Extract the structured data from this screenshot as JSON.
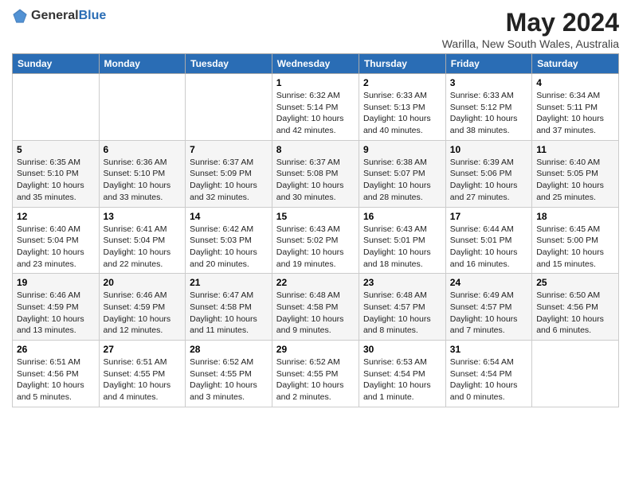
{
  "logo": {
    "general": "General",
    "blue": "Blue"
  },
  "header": {
    "title": "May 2024",
    "location": "Warilla, New South Wales, Australia"
  },
  "days_of_week": [
    "Sunday",
    "Monday",
    "Tuesday",
    "Wednesday",
    "Thursday",
    "Friday",
    "Saturday"
  ],
  "weeks": [
    [
      {
        "day": "",
        "info": ""
      },
      {
        "day": "",
        "info": ""
      },
      {
        "day": "",
        "info": ""
      },
      {
        "day": "1",
        "info": "Sunrise: 6:32 AM\nSunset: 5:14 PM\nDaylight: 10 hours\nand 42 minutes."
      },
      {
        "day": "2",
        "info": "Sunrise: 6:33 AM\nSunset: 5:13 PM\nDaylight: 10 hours\nand 40 minutes."
      },
      {
        "day": "3",
        "info": "Sunrise: 6:33 AM\nSunset: 5:12 PM\nDaylight: 10 hours\nand 38 minutes."
      },
      {
        "day": "4",
        "info": "Sunrise: 6:34 AM\nSunset: 5:11 PM\nDaylight: 10 hours\nand 37 minutes."
      }
    ],
    [
      {
        "day": "5",
        "info": "Sunrise: 6:35 AM\nSunset: 5:10 PM\nDaylight: 10 hours\nand 35 minutes."
      },
      {
        "day": "6",
        "info": "Sunrise: 6:36 AM\nSunset: 5:10 PM\nDaylight: 10 hours\nand 33 minutes."
      },
      {
        "day": "7",
        "info": "Sunrise: 6:37 AM\nSunset: 5:09 PM\nDaylight: 10 hours\nand 32 minutes."
      },
      {
        "day": "8",
        "info": "Sunrise: 6:37 AM\nSunset: 5:08 PM\nDaylight: 10 hours\nand 30 minutes."
      },
      {
        "day": "9",
        "info": "Sunrise: 6:38 AM\nSunset: 5:07 PM\nDaylight: 10 hours\nand 28 minutes."
      },
      {
        "day": "10",
        "info": "Sunrise: 6:39 AM\nSunset: 5:06 PM\nDaylight: 10 hours\nand 27 minutes."
      },
      {
        "day": "11",
        "info": "Sunrise: 6:40 AM\nSunset: 5:05 PM\nDaylight: 10 hours\nand 25 minutes."
      }
    ],
    [
      {
        "day": "12",
        "info": "Sunrise: 6:40 AM\nSunset: 5:04 PM\nDaylight: 10 hours\nand 23 minutes."
      },
      {
        "day": "13",
        "info": "Sunrise: 6:41 AM\nSunset: 5:04 PM\nDaylight: 10 hours\nand 22 minutes."
      },
      {
        "day": "14",
        "info": "Sunrise: 6:42 AM\nSunset: 5:03 PM\nDaylight: 10 hours\nand 20 minutes."
      },
      {
        "day": "15",
        "info": "Sunrise: 6:43 AM\nSunset: 5:02 PM\nDaylight: 10 hours\nand 19 minutes."
      },
      {
        "day": "16",
        "info": "Sunrise: 6:43 AM\nSunset: 5:01 PM\nDaylight: 10 hours\nand 18 minutes."
      },
      {
        "day": "17",
        "info": "Sunrise: 6:44 AM\nSunset: 5:01 PM\nDaylight: 10 hours\nand 16 minutes."
      },
      {
        "day": "18",
        "info": "Sunrise: 6:45 AM\nSunset: 5:00 PM\nDaylight: 10 hours\nand 15 minutes."
      }
    ],
    [
      {
        "day": "19",
        "info": "Sunrise: 6:46 AM\nSunset: 4:59 PM\nDaylight: 10 hours\nand 13 minutes."
      },
      {
        "day": "20",
        "info": "Sunrise: 6:46 AM\nSunset: 4:59 PM\nDaylight: 10 hours\nand 12 minutes."
      },
      {
        "day": "21",
        "info": "Sunrise: 6:47 AM\nSunset: 4:58 PM\nDaylight: 10 hours\nand 11 minutes."
      },
      {
        "day": "22",
        "info": "Sunrise: 6:48 AM\nSunset: 4:58 PM\nDaylight: 10 hours\nand 9 minutes."
      },
      {
        "day": "23",
        "info": "Sunrise: 6:48 AM\nSunset: 4:57 PM\nDaylight: 10 hours\nand 8 minutes."
      },
      {
        "day": "24",
        "info": "Sunrise: 6:49 AM\nSunset: 4:57 PM\nDaylight: 10 hours\nand 7 minutes."
      },
      {
        "day": "25",
        "info": "Sunrise: 6:50 AM\nSunset: 4:56 PM\nDaylight: 10 hours\nand 6 minutes."
      }
    ],
    [
      {
        "day": "26",
        "info": "Sunrise: 6:51 AM\nSunset: 4:56 PM\nDaylight: 10 hours\nand 5 minutes."
      },
      {
        "day": "27",
        "info": "Sunrise: 6:51 AM\nSunset: 4:55 PM\nDaylight: 10 hours\nand 4 minutes."
      },
      {
        "day": "28",
        "info": "Sunrise: 6:52 AM\nSunset: 4:55 PM\nDaylight: 10 hours\nand 3 minutes."
      },
      {
        "day": "29",
        "info": "Sunrise: 6:52 AM\nSunset: 4:55 PM\nDaylight: 10 hours\nand 2 minutes."
      },
      {
        "day": "30",
        "info": "Sunrise: 6:53 AM\nSunset: 4:54 PM\nDaylight: 10 hours\nand 1 minute."
      },
      {
        "day": "31",
        "info": "Sunrise: 6:54 AM\nSunset: 4:54 PM\nDaylight: 10 hours\nand 0 minutes."
      },
      {
        "day": "",
        "info": ""
      }
    ]
  ]
}
